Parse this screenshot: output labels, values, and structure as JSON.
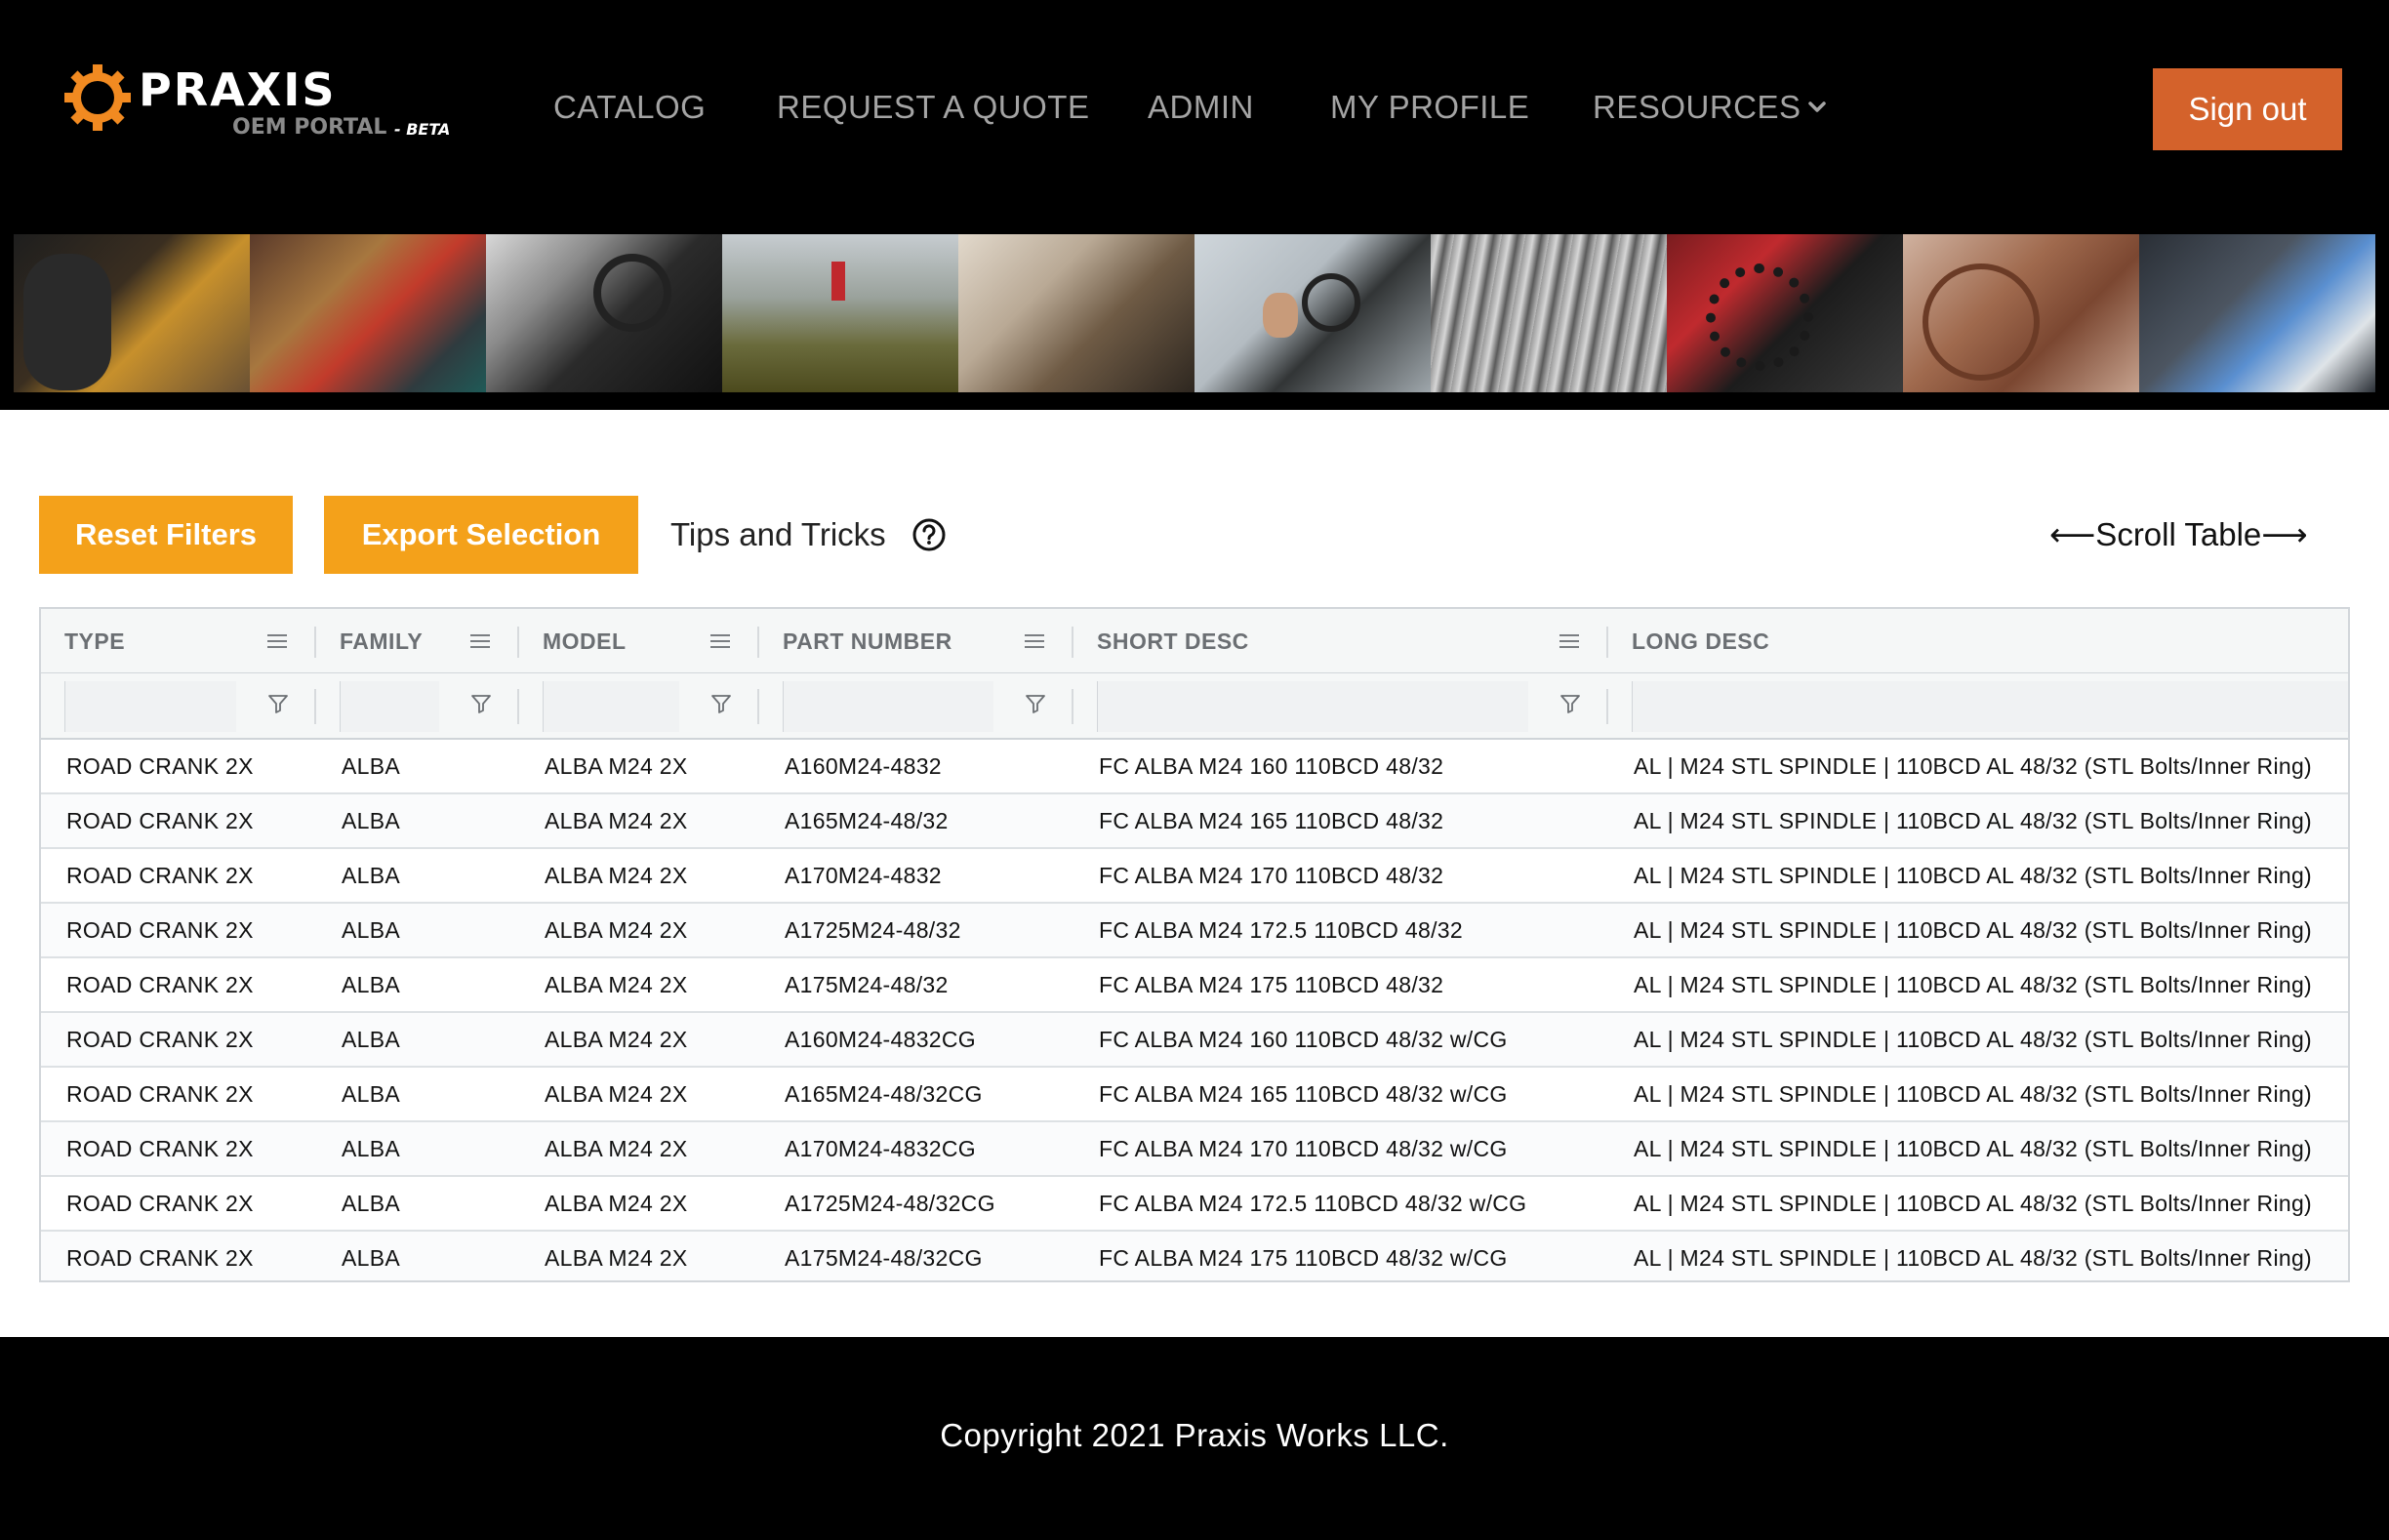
{
  "header": {
    "logo": {
      "wordmark": "PRAXIS",
      "subtitle": "OEM PORTAL",
      "badge": "- BETA",
      "accent_color": "#f18a21"
    },
    "nav": [
      {
        "label": "CATALOG"
      },
      {
        "label": "REQUEST A QUOTE"
      },
      {
        "label": "ADMIN"
      },
      {
        "label": "MY PROFILE"
      },
      {
        "label": "RESOURCES",
        "icon": "chevron-down-icon"
      }
    ],
    "sign_out_label": "Sign out",
    "sign_out_color": "#d4622b"
  },
  "toolbar": {
    "reset_label": "Reset Filters",
    "export_label": "Export Selection",
    "button_color": "#f4a11a",
    "tips_label": "Tips and Tricks",
    "tips_icon": "question-circle-icon",
    "scroll_hint": "⟵Scroll Table⟶"
  },
  "table": {
    "columns": [
      "TYPE",
      "FAMILY",
      "MODEL",
      "PART NUMBER",
      "SHORT DESC",
      "LONG DESC"
    ],
    "rows": [
      [
        "ROAD CRANK 2X",
        "ALBA",
        "ALBA M24 2X",
        "A160M24-4832",
        "FC ALBA M24 160 110BCD 48/32",
        "AL | M24 STL SPINDLE | 110BCD AL 48/32 (STL Bolts/Inner Ring)"
      ],
      [
        "ROAD CRANK 2X",
        "ALBA",
        "ALBA M24 2X",
        "A165M24-48/32",
        "FC ALBA M24 165 110BCD 48/32",
        "AL | M24 STL SPINDLE | 110BCD AL 48/32 (STL Bolts/Inner Ring)"
      ],
      [
        "ROAD CRANK 2X",
        "ALBA",
        "ALBA M24 2X",
        "A170M24-4832",
        "FC ALBA M24 170 110BCD 48/32",
        "AL | M24 STL SPINDLE | 110BCD AL 48/32 (STL Bolts/Inner Ring)"
      ],
      [
        "ROAD CRANK 2X",
        "ALBA",
        "ALBA M24 2X",
        "A1725M24-48/32",
        "FC ALBA M24 172.5 110BCD 48/32",
        "AL | M24 STL SPINDLE | 110BCD AL 48/32 (STL Bolts/Inner Ring)"
      ],
      [
        "ROAD CRANK 2X",
        "ALBA",
        "ALBA M24 2X",
        "A175M24-48/32",
        "FC ALBA M24 175 110BCD 48/32",
        "AL | M24 STL SPINDLE | 110BCD AL 48/32 (STL Bolts/Inner Ring)"
      ],
      [
        "ROAD CRANK 2X",
        "ALBA",
        "ALBA M24 2X",
        "A160M24-4832CG",
        "FC ALBA M24 160 110BCD 48/32 w/CG",
        "AL | M24 STL SPINDLE | 110BCD AL 48/32 (STL Bolts/Inner Ring)"
      ],
      [
        "ROAD CRANK 2X",
        "ALBA",
        "ALBA M24 2X",
        "A165M24-48/32CG",
        "FC ALBA M24 165 110BCD 48/32 w/CG",
        "AL | M24 STL SPINDLE | 110BCD AL 48/32 (STL Bolts/Inner Ring)"
      ],
      [
        "ROAD CRANK 2X",
        "ALBA",
        "ALBA M24 2X",
        "A170M24-4832CG",
        "FC ALBA M24 170 110BCD 48/32 w/CG",
        "AL | M24 STL SPINDLE | 110BCD AL 48/32 (STL Bolts/Inner Ring)"
      ],
      [
        "ROAD CRANK 2X",
        "ALBA",
        "ALBA M24 2X",
        "A1725M24-48/32CG",
        "FC ALBA M24 172.5 110BCD 48/32 w/CG",
        "AL | M24 STL SPINDLE | 110BCD AL 48/32 (STL Bolts/Inner Ring)"
      ],
      [
        "ROAD CRANK 2X",
        "ALBA",
        "ALBA M24 2X",
        "A175M24-48/32CG",
        "FC ALBA M24 175 110BCD 48/32 w/CG",
        "AL | M24 STL SPINDLE | 110BCD AL 48/32 (STL Bolts/Inner Ring)"
      ]
    ]
  },
  "footer": {
    "copyright": "Copyright 2021 Praxis Works LLC."
  }
}
